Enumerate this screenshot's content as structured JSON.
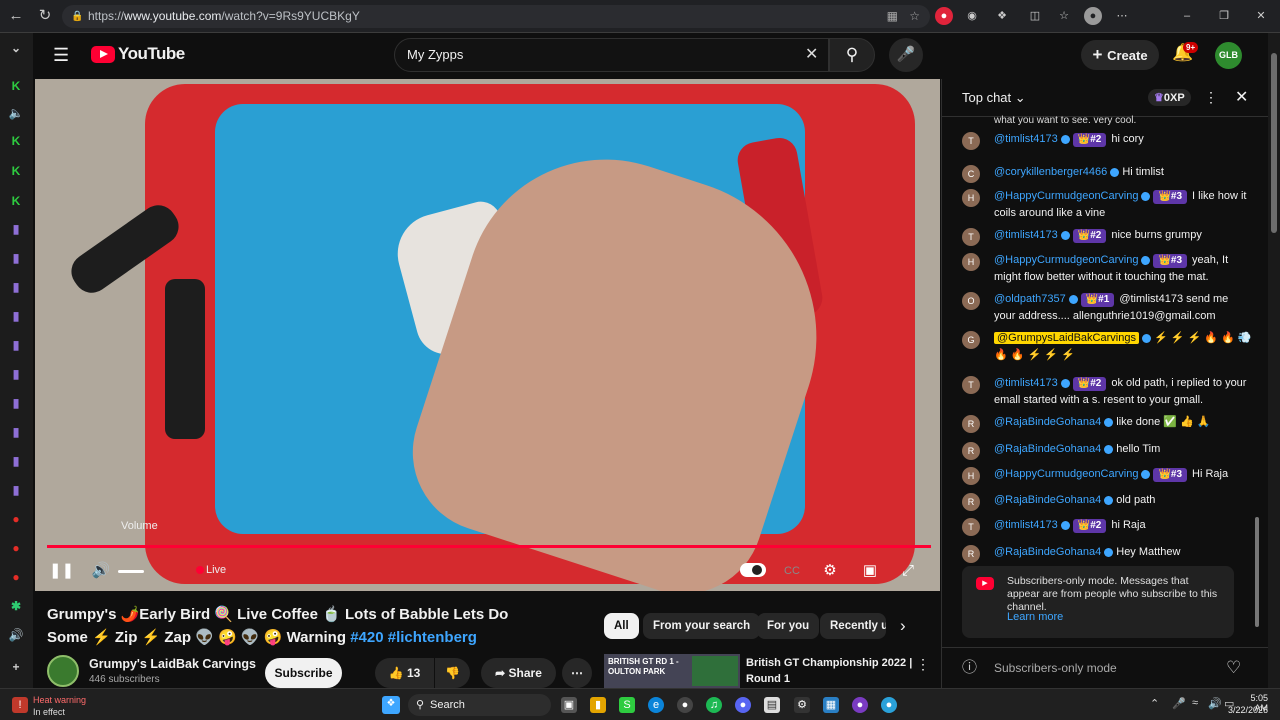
{
  "browser": {
    "url_prefix": "https://",
    "url_host": "www.youtube.com",
    "url_path": "/watch?v=9Rs9YUCBKgY"
  },
  "masthead": {
    "logo_text": "YouTube",
    "search_value": "My Zypps",
    "create_label": "Create",
    "notif_badge": "9+"
  },
  "player": {
    "volume_tooltip": "Volume",
    "live_label": "Live"
  },
  "video": {
    "title_line1": "Grumpy's 🌶️Early Bird 🍭 Live Coffee 🍵  Lots of Babble Lets Do",
    "title_line2_prefix": "Some ⚡ Zip ⚡ Zap 👽 🤪 👽 🤪 Warning ",
    "tag1": "#420",
    "tag2": "#lichtenberg",
    "channel_name": "Grumpy's LaidBak Carvings",
    "subscribers": "446 subscribers",
    "subscribe_label": "Subscribe",
    "likes": "13",
    "share_label": "Share"
  },
  "chips": [
    "All",
    "From your search",
    "For you",
    "Recently up"
  ],
  "recommended": {
    "thumb_text": "BRITISH GT RD 1 - OULTON PARK",
    "title_line1": "British GT Championship 2022  |",
    "title_line2": "Round 1"
  },
  "chat": {
    "header": "Top chat",
    "xp": "0XP",
    "truncated_text": "what you want to see. very cool.",
    "messages": [
      {
        "author": "@timlist4173",
        "badge": "👑#2",
        "text": "hi cory",
        "avatar": "T"
      },
      {
        "author": "@corykillenberger4466",
        "badge": "",
        "text": "Hi timlist",
        "avatar": "C"
      },
      {
        "author": "@HappyCurmudgeonCarving",
        "badge": "👑#3",
        "text": "I like how it coils around like a vine",
        "avatar": "H"
      },
      {
        "author": "@timlist4173",
        "badge": "👑#2",
        "text": "nice burns grumpy",
        "avatar": "T"
      },
      {
        "author": "@HappyCurmudgeonCarving",
        "badge": "👑#3",
        "text": "yeah, It might flow better without it touching the mat.",
        "avatar": "H"
      },
      {
        "author": "@oldpath7357",
        "badge": "👑#1",
        "text": "@timlist4173 send me your address.... allenguthrie1019@gmail.com",
        "avatar": "O"
      },
      {
        "author": "@GrumpysLaidBakCarvings",
        "badge": "",
        "text": "⚡ ⚡ ⚡ 🔥 🔥 💨 🔥 🔥 ⚡ ⚡ ⚡",
        "avatar": "G"
      },
      {
        "author": "@timlist4173",
        "badge": "👑#2",
        "text": "ok old path, i replied to your emall started with a s. resent to your gmall.",
        "avatar": "T"
      },
      {
        "author": "@RajaBindeGohana4",
        "badge": "",
        "text": "like done ✅ 👍 🙏",
        "avatar": "R"
      },
      {
        "author": "@RajaBindeGohana4",
        "badge": "",
        "text": "hello Tim",
        "avatar": "R"
      },
      {
        "author": "@HappyCurmudgeonCarving",
        "badge": "👑#3",
        "text": "Hi Raja",
        "avatar": "H"
      },
      {
        "author": "@RajaBindeGohana4",
        "badge": "",
        "text": "old path",
        "avatar": "R"
      },
      {
        "author": "@timlist4173",
        "badge": "👑#2",
        "text": "hi Raja",
        "avatar": "T"
      },
      {
        "author": "@RajaBindeGohana4",
        "badge": "",
        "text": "Hey Matthew",
        "avatar": "R"
      }
    ],
    "notice_text": "Subscribers-only mode. Messages that appear are from people who subscribe to this channel.",
    "learn_more": "Learn more",
    "input_placeholder": "Subscribers-only mode"
  },
  "taskbar": {
    "weather_line1": "Heat warning",
    "weather_line2": "In effect",
    "search_label": "Search",
    "time": "5:05 AM",
    "date": "3/22/2026"
  },
  "colors": {
    "accent": "#ff0033",
    "link": "#3ea6ff",
    "badge": "#5e36a8"
  }
}
